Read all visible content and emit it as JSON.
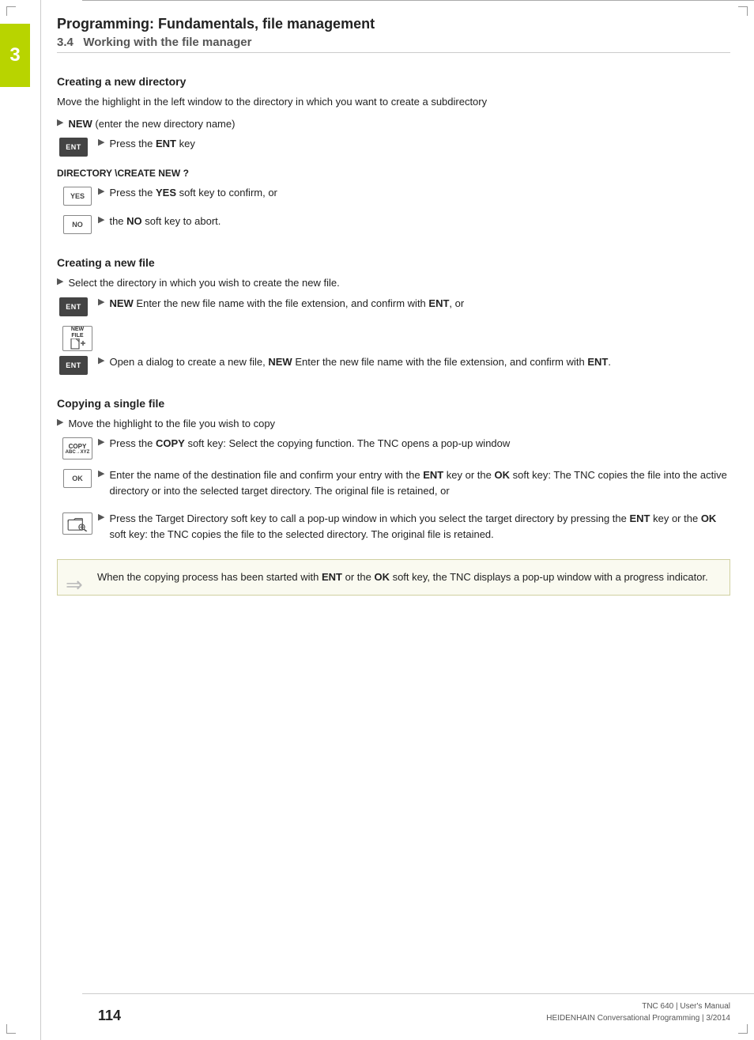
{
  "page": {
    "chapter_number": "3",
    "chapter_title": "Programming: Fundamentals, file management",
    "section_number": "3.4",
    "section_title": "Working with the file manager",
    "page_number": "114",
    "footer_line1": "TNC 640 | User's Manual",
    "footer_line2": "HEIDENHAIN Conversational Programming | 3/2014"
  },
  "creating_directory": {
    "heading": "Creating a new directory",
    "intro": "Move the highlight in the left window to the directory in which you want to create a subdirectory",
    "step1_arrow": "▶",
    "step1_text_pre": "",
    "step1_new": "NEW",
    "step1_text_post": " (enter the new directory name)",
    "ent_key": "ENT",
    "step2_arrow": "▶",
    "step2_text": "Press the ",
    "step2_bold": "ENT",
    "step2_text2": " key",
    "dir_prompt": "DIRECTORY \\CREATE NEW ?",
    "yes_key": "YES",
    "no_key": "NO",
    "step3_arrow": "▶",
    "step3_text": "Press the ",
    "step3_bold": "YES",
    "step3_text2": " soft key to confirm, or",
    "step4_arrow": "▶",
    "step4_text": "the ",
    "step4_bold": "NO",
    "step4_text2": " soft key to abort."
  },
  "creating_file": {
    "heading": "Creating a new file",
    "step1_arrow": "▶",
    "step1_text": "Select the directory in which you wish to create the new file.",
    "ent_key": "ENT",
    "step2_arrow": "▶",
    "step2_text_pre": "",
    "step2_new": "NEW",
    "step2_bold": "ENT",
    "step2_text": " Enter the new file name with the file extension, and confirm with ",
    "step2_text2": ", or",
    "newfile_key_line1": "NEW",
    "newfile_key_line2": "FILE",
    "ent_key2": "ENT",
    "step3_arrow": "▶",
    "step3_text": "Open a dialog to create a new file, ",
    "step3_new": "NEW",
    "step3_bold": "ENT",
    "step3_text2": " Enter the new file name with the file extension, and confirm with ",
    "step3_text3": "."
  },
  "copying_file": {
    "heading": "Copying a single file",
    "step1_arrow": "▶",
    "step1_text": "Move the highlight to the file you wish to copy",
    "copy_key_top": "COPY",
    "copy_key_bottom": "ABC→XYZ",
    "step2_arrow": "▶",
    "step2_text": "Press the ",
    "step2_bold": "COPY",
    "step2_text2": " soft key: Select the copying function. The TNC opens a pop-up window",
    "ok_key": "OK",
    "step3_arrow": "▶",
    "step3_text": "Enter the name of the destination file and confirm your entry with the ",
    "step3_bold1": "ENT",
    "step3_text2": " key or the ",
    "step3_bold2": "OK",
    "step3_text3": " soft key: The TNC copies the file into the active directory or into the selected target directory. The original file is retained, or",
    "step4_arrow": "▶",
    "step4_text": "Press the Target Directory soft key to call a pop-up window in which you select the target directory by pressing the ",
    "step4_bold1": "ENT",
    "step4_text2": " key or the ",
    "step4_bold2": "OK",
    "step4_text3": " soft key: the TNC copies the file to the selected directory. The original file is retained.",
    "note_text": "When the copying process has been started with ",
    "note_bold1": "ENT",
    "note_text2": " or the ",
    "note_bold2": "OK",
    "note_text3": " soft key, the TNC displays a pop-up window with a progress indicator."
  }
}
